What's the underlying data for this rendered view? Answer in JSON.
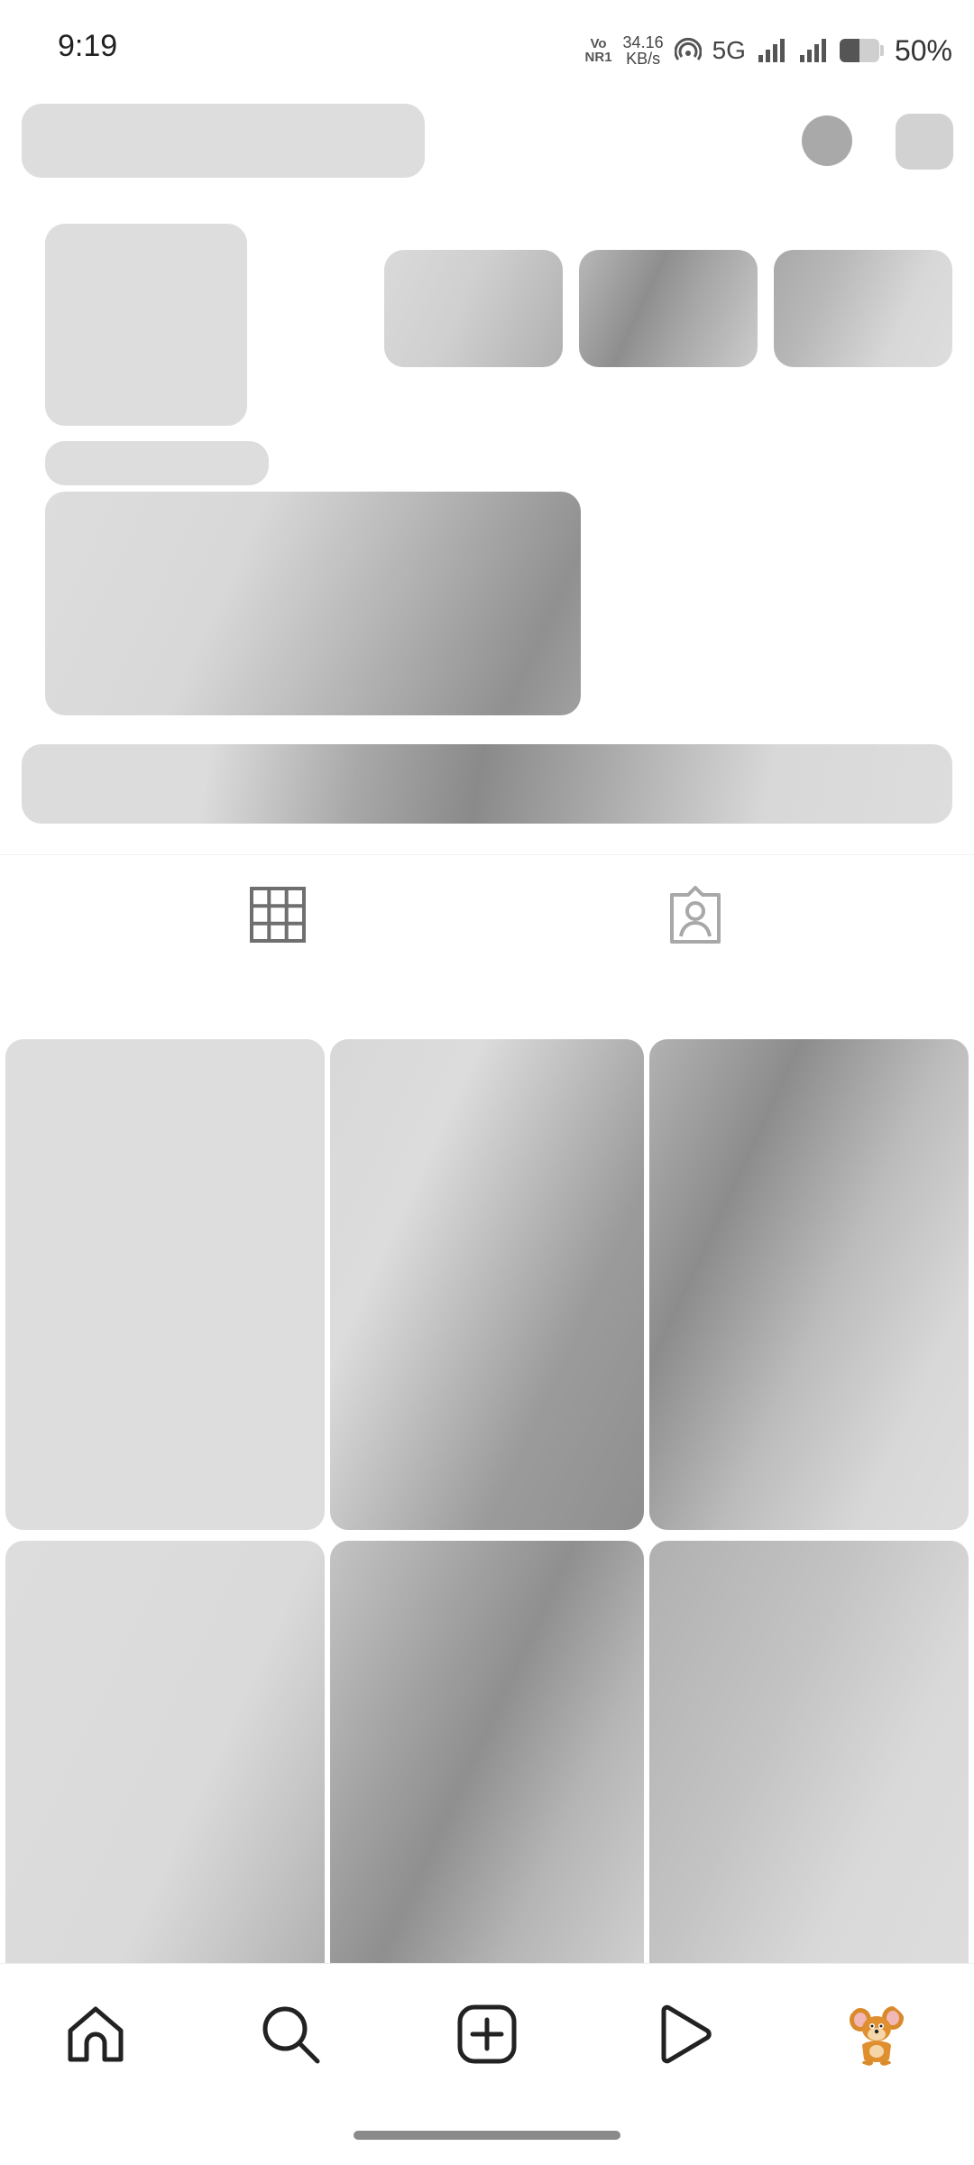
{
  "status_bar": {
    "time": "9:19",
    "volte_top": "Vo",
    "volte_bottom": "NR1",
    "speed_value": "34.16",
    "speed_unit": "KB/s",
    "network": "5G",
    "battery": "50%",
    "battery_level": 0.5
  },
  "profile_tabs": {
    "grid_icon": "grid-icon",
    "tagged_icon": "tagged-person-icon",
    "selected": "grid"
  },
  "bottom_nav": {
    "items": [
      "home-icon",
      "search-icon",
      "create-post-icon",
      "reels-icon",
      "profile-avatar"
    ]
  },
  "colors": {
    "skeleton": "#dddddd",
    "shimmer_dark": "#8e8e8e",
    "icon_dark": "#222222",
    "icon_grey": "#8a8a8a"
  }
}
